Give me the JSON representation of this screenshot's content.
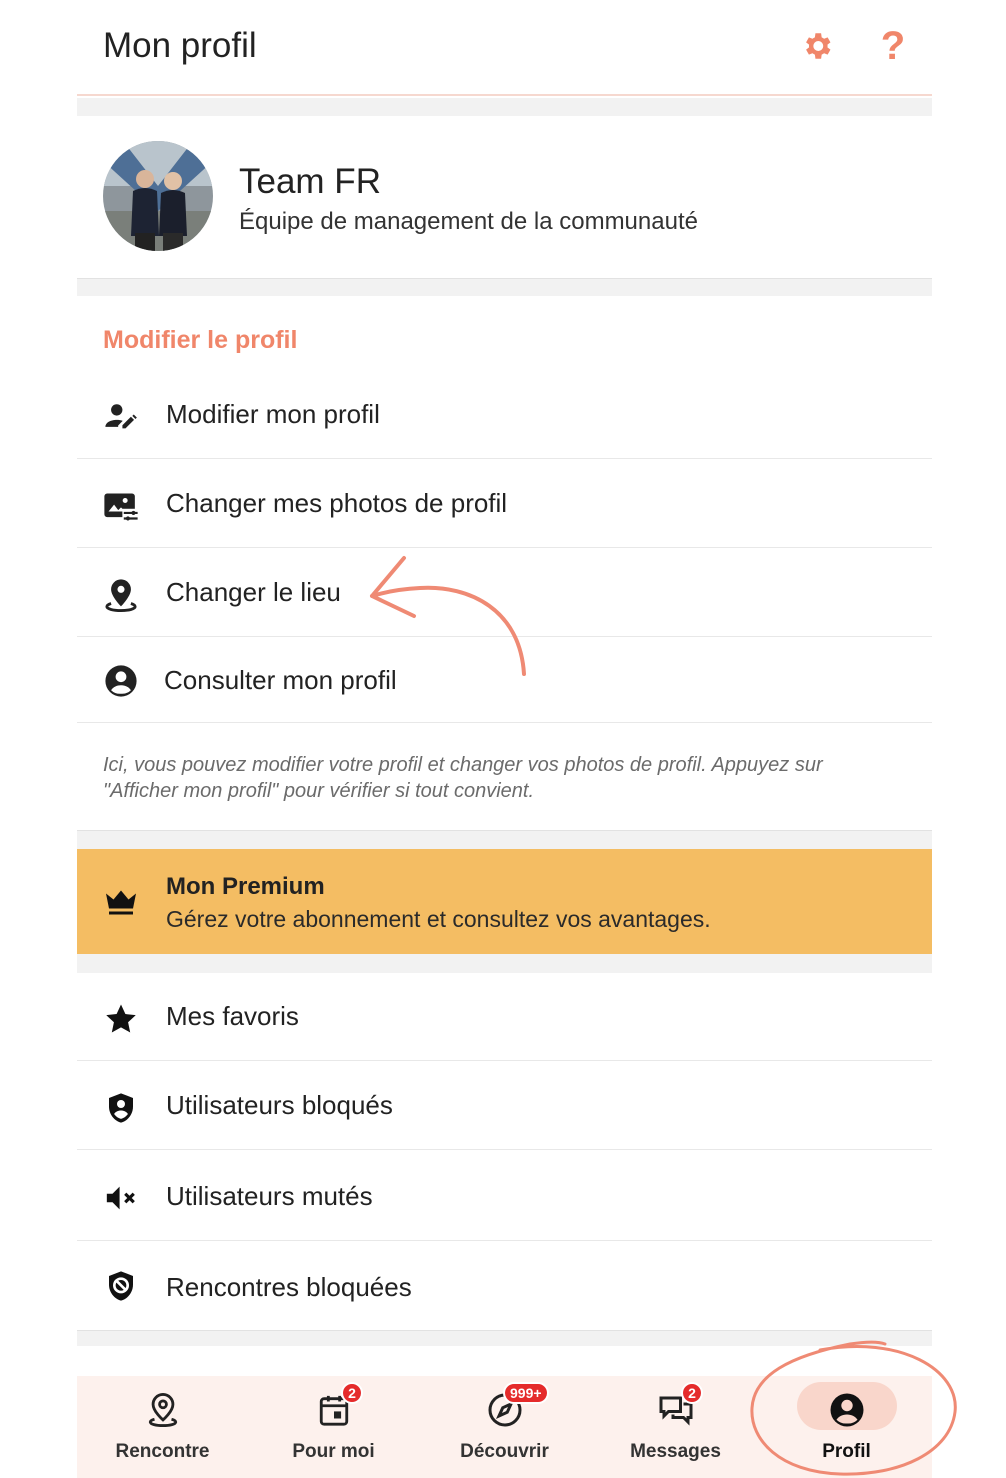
{
  "header": {
    "title": "Mon profil"
  },
  "profile": {
    "name": "Team FR",
    "subtitle": "Équipe de management de la communauté"
  },
  "edit_section": {
    "title": "Modifier le profil",
    "items": [
      {
        "label": "Modifier mon profil",
        "icon": "person-edit-icon"
      },
      {
        "label": "Changer mes photos de profil",
        "icon": "photo-settings-icon"
      },
      {
        "label": "Changer le lieu",
        "icon": "location-pin-icon"
      },
      {
        "label": "Consulter mon profil",
        "icon": "account-circle-icon"
      }
    ],
    "note": "Ici, vous pouvez modifier votre profil et changer vos photos de profil. Appuyez sur \"Afficher mon profil\" pour vérifier si tout convient."
  },
  "premium": {
    "title": "Mon Premium",
    "subtitle": "Gérez votre abonnement et consultez vos avantages.",
    "icon": "crown-icon"
  },
  "other_items": [
    {
      "label": "Mes favoris",
      "icon": "star-icon"
    },
    {
      "label": "Utilisateurs bloqués",
      "icon": "shield-person-icon"
    },
    {
      "label": "Utilisateurs mutés",
      "icon": "mute-icon"
    },
    {
      "label": "Rencontres bloquées",
      "icon": "shield-block-icon"
    }
  ],
  "nav": [
    {
      "label": "Rencontre",
      "icon": "location-pin-icon",
      "badge": ""
    },
    {
      "label": "Pour moi",
      "icon": "calendar-icon",
      "badge": "2"
    },
    {
      "label": "Découvrir",
      "icon": "compass-icon",
      "badge": "999+"
    },
    {
      "label": "Messages",
      "icon": "chat-icon",
      "badge": "2"
    },
    {
      "label": "Profil",
      "icon": "account-circle-icon",
      "badge": "",
      "active": true
    }
  ],
  "colors": {
    "accent": "#f0866a",
    "premium": "#f4bd63",
    "nav_bg": "#fdf1ed",
    "badge": "#e52b2b"
  }
}
